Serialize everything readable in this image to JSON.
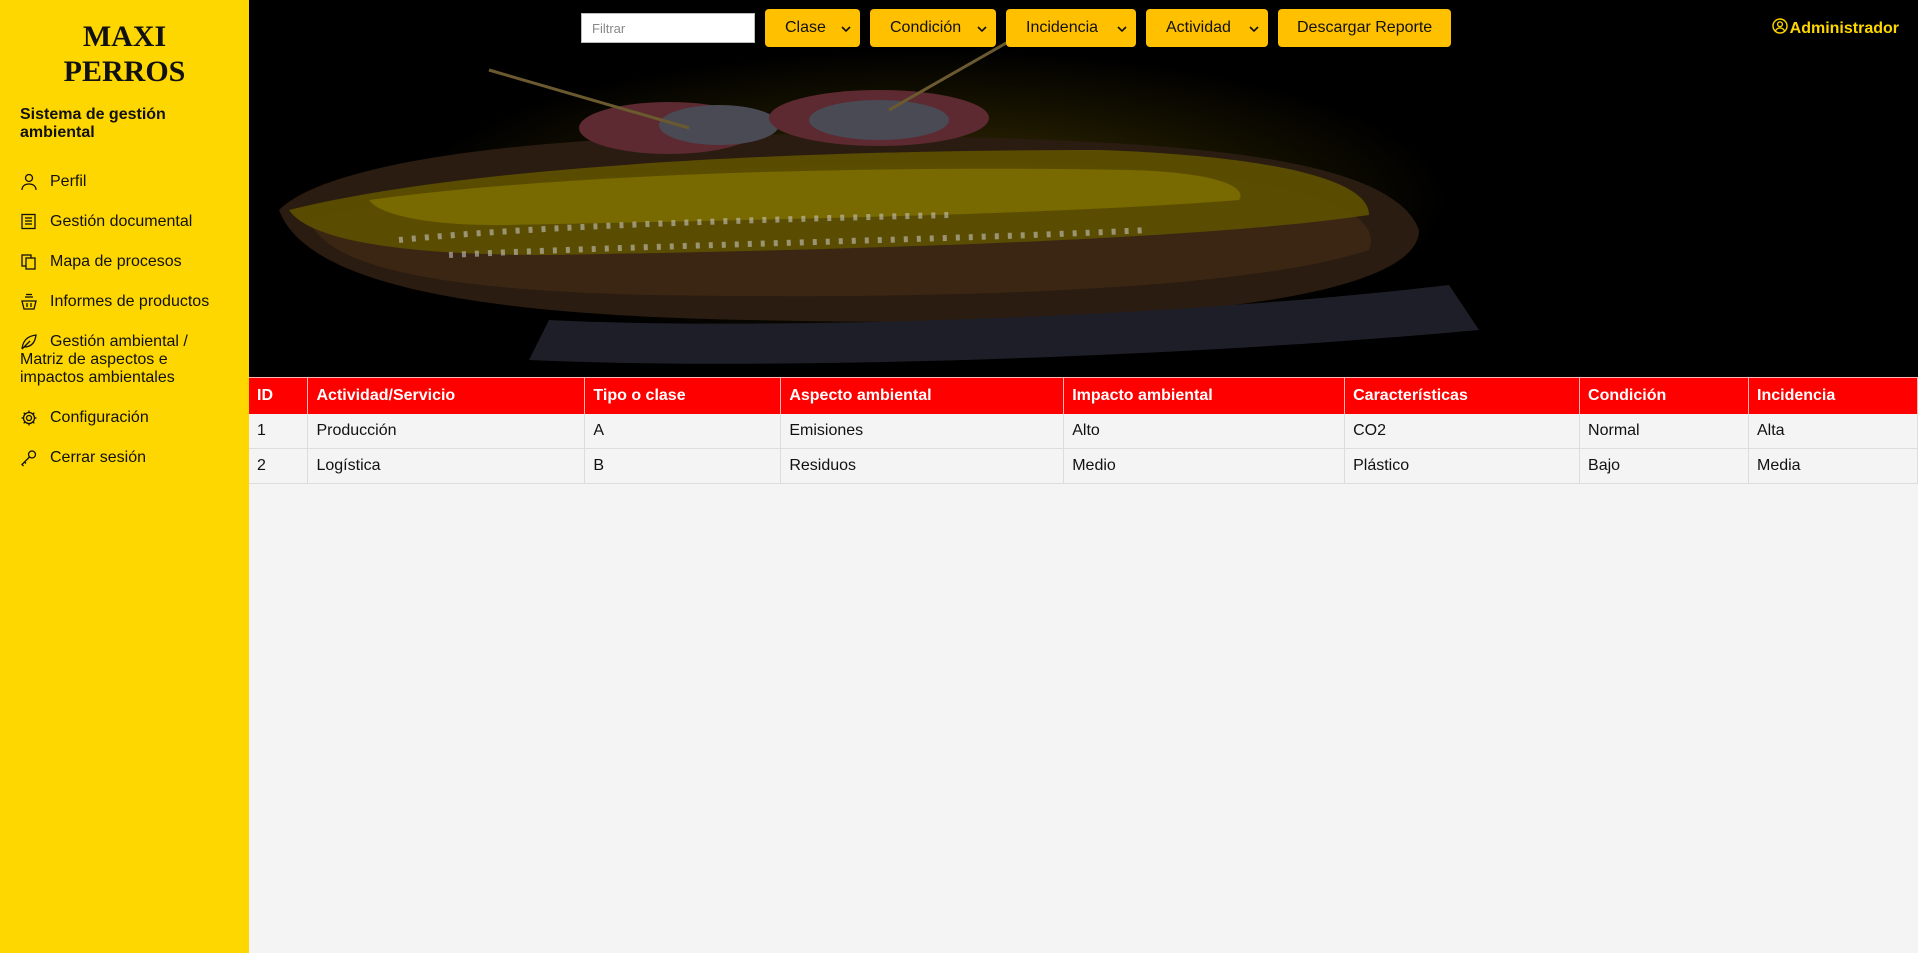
{
  "sidebar": {
    "brand_line1": "MAXI",
    "brand_line2": "PERROS",
    "subtitle": "Sistema de gestión ambiental",
    "items": [
      {
        "label": "Perfil",
        "icon": "person-icon"
      },
      {
        "label": "Gestión documental",
        "icon": "document-icon"
      },
      {
        "label": "Mapa de procesos",
        "icon": "copy-icon"
      },
      {
        "label": "Informes de productos",
        "icon": "basket-icon"
      },
      {
        "label": "Gestión ambiental / Matriz de aspectos e impactos ambientales",
        "icon": "leaf-icon"
      },
      {
        "label": "Configuración",
        "icon": "gear-icon"
      },
      {
        "label": "Cerrar sesión",
        "icon": "key-icon"
      }
    ]
  },
  "toolbar": {
    "filter_placeholder": "Filtrar",
    "dropdowns": [
      "Clase",
      "Condición",
      "Incidencia",
      "Actividad"
    ],
    "report_label": "Descargar Reporte"
  },
  "user": {
    "label": "Administrador",
    "icon": "user-circle-icon"
  },
  "table": {
    "headers": [
      "ID",
      "Actividad/Servicio",
      "Tipo o clase",
      "Aspecto ambiental",
      "Impacto ambiental",
      "Características",
      "Condición",
      "Incidencia"
    ],
    "rows": [
      [
        "1",
        "Producción",
        "A",
        "Emisiones",
        "Alto",
        "CO2",
        "Normal",
        "Alta"
      ],
      [
        "2",
        "Logística",
        "B",
        "Residuos",
        "Medio",
        "Plástico",
        "Bajo",
        "Media"
      ]
    ]
  },
  "colors": {
    "sidebar_bg": "#ffd700",
    "button_bg": "#ffc000",
    "table_header_bg": "#ff0000",
    "admin_text": "#ffd700"
  }
}
